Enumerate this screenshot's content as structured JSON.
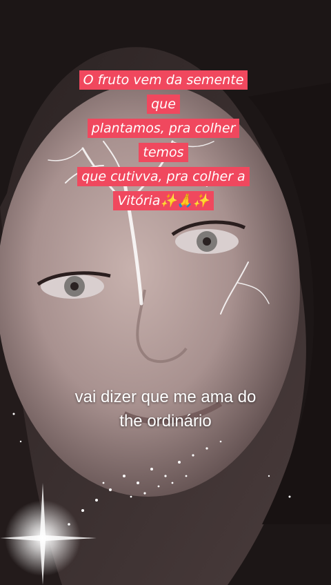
{
  "caption": {
    "lines": [
      "O fruto vem da semente que",
      "plantamos, pra colher temos",
      "que cutivva, pra colher a",
      "Vitória✨🙏✨"
    ],
    "background_color": "#f0485e"
  },
  "lyric": {
    "line1": "vai dizer que me ama do",
    "line2": "the ordinário"
  }
}
